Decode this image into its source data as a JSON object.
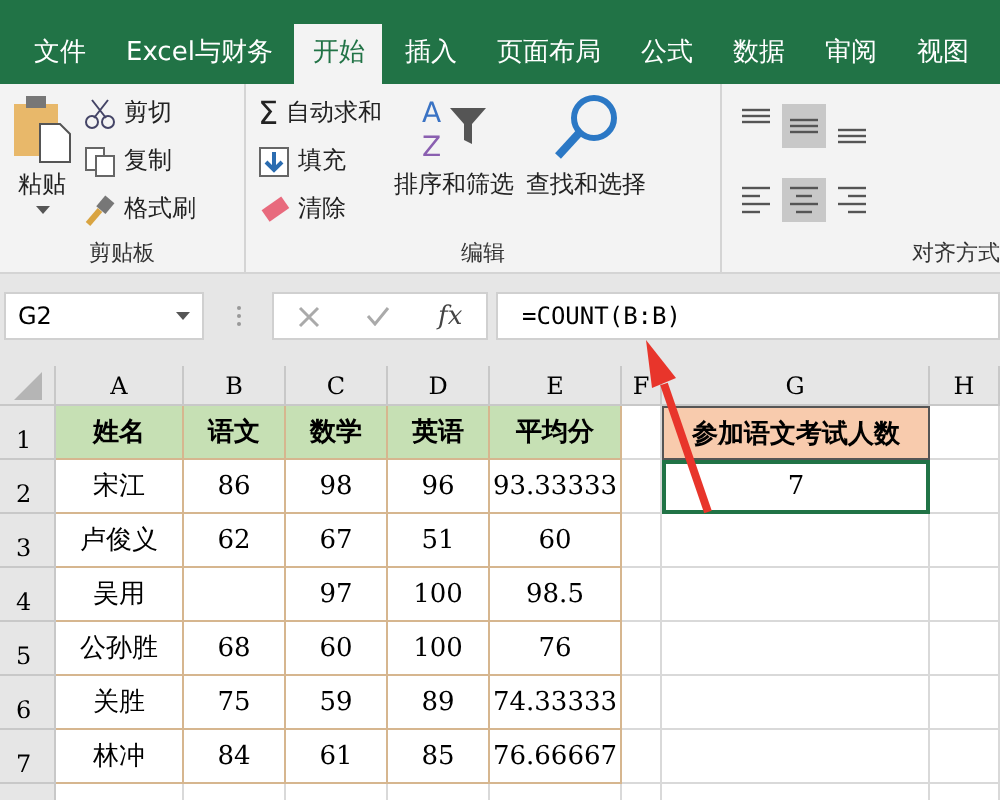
{
  "tabs": [
    {
      "label": "文件",
      "selected": false
    },
    {
      "label": "Excel与财务",
      "selected": false
    },
    {
      "label": "开始",
      "selected": true
    },
    {
      "label": "插入",
      "selected": false
    },
    {
      "label": "页面布局",
      "selected": false
    },
    {
      "label": "公式",
      "selected": false
    },
    {
      "label": "数据",
      "selected": false
    },
    {
      "label": "审阅",
      "selected": false
    },
    {
      "label": "视图",
      "selected": false
    }
  ],
  "clipboard": {
    "paste": "粘贴",
    "cut": "剪切",
    "copy": "复制",
    "format_painter": "格式刷",
    "label": "剪贴板"
  },
  "editing": {
    "autosum_symbol": "Σ",
    "sort_letters": [
      "A",
      "Z"
    ],
    "autosum": "自动求和",
    "fill": "填充",
    "clear": "清除",
    "sort_filter": "排序和筛选",
    "find_select": "查找和选择",
    "label": "编辑"
  },
  "alignment": {
    "label": "对齐方式",
    "buttons": [
      {
        "kind": "top",
        "selected": false
      },
      {
        "kind": "middle",
        "selected": true
      },
      {
        "kind": "bottom",
        "selected": false
      },
      {
        "kind": "left",
        "selected": false
      },
      {
        "kind": "center",
        "selected": true
      },
      {
        "kind": "right",
        "selected": false
      }
    ]
  },
  "formula_bar": {
    "name_box": "G2",
    "fx": "fx",
    "formula": "=COUNT(B:B)"
  },
  "columns": [
    "A",
    "B",
    "C",
    "D",
    "E",
    "F",
    "G",
    "H"
  ],
  "rows": [
    {
      "number": "1",
      "kind": "header",
      "cells": [
        "姓名",
        "语文",
        "数学",
        "英语",
        "平均分"
      ],
      "summary": {
        "text": "参加语文考试人数",
        "kind": "title",
        "selected": false
      }
    },
    {
      "number": "2",
      "kind": "data",
      "cells": [
        "宋江",
        "86",
        "98",
        "96",
        "93.33333"
      ],
      "summary": {
        "text": "7",
        "kind": "value",
        "selected": true
      }
    },
    {
      "number": "3",
      "kind": "data",
      "cells": [
        "卢俊义",
        "62",
        "67",
        "51",
        "60"
      ]
    },
    {
      "number": "4",
      "kind": "data",
      "cells": [
        "吴用",
        "",
        "97",
        "100",
        "98.5"
      ]
    },
    {
      "number": "5",
      "kind": "data",
      "cells": [
        "公孙胜",
        "68",
        "60",
        "100",
        "76"
      ]
    },
    {
      "number": "6",
      "kind": "data",
      "cells": [
        "关胜",
        "75",
        "59",
        "89",
        "74.33333"
      ]
    },
    {
      "number": "7",
      "kind": "data",
      "cells": [
        "林冲",
        "84",
        "61",
        "85",
        "76.66667"
      ]
    }
  ]
}
